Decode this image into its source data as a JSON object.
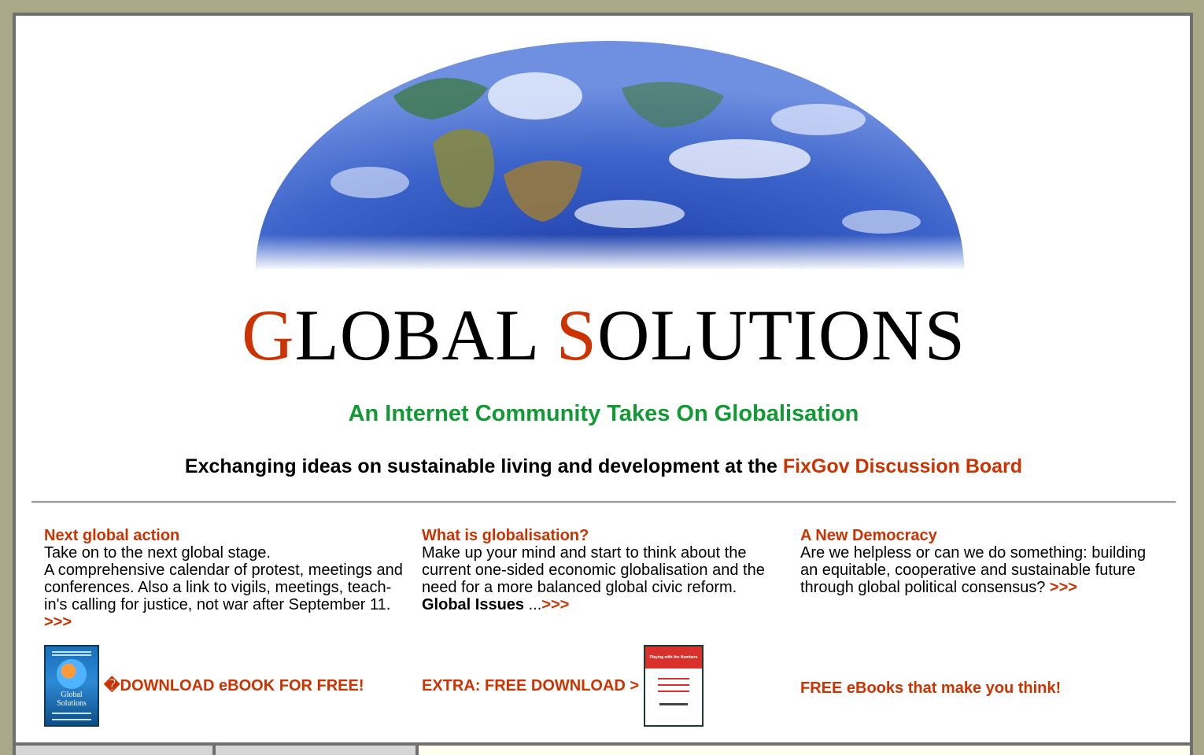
{
  "header": {
    "title_initial_1": "G",
    "title_rest_1": "LOBAL",
    "title_initial_2": "S",
    "title_rest_2": "OLUTIONS",
    "tagline": "An Internet Community Takes On Globalisation",
    "exchange_text": "Exchanging ideas on sustainable living and development at the",
    "exchange_link": "FixGov Discussion Board"
  },
  "columns": [
    {
      "heading": "Next global action",
      "line1": "Take on to the next global stage.",
      "body": "A comprehensive calendar of protest, meetings and conferences. Also a link to vigils, meetings, teach-in's calling for justice, not war after September 11.",
      "more": ">>>"
    },
    {
      "heading": "What is globalisation?",
      "body": "Make up your mind and start to think about the current one-sided economic globalisation and the need for a more balanced global civic reform.",
      "bold_link": "Global Issues",
      "ellipsis": " ...",
      "more": ">>>"
    },
    {
      "heading": "A New Democracy",
      "body": "Are we helpless or can we do something: building an equitable, cooperative and sustainable future through global political consensus?",
      "more": ">>>"
    }
  ],
  "promos": {
    "download_ebook": "�DOWNLOAD eBOOK FOR FREE!",
    "extra_download": "EXTRA: FREE DOWNLOAD >",
    "free_ebooks": "FREE eBooks that make you think!"
  },
  "book_covers": {
    "global_solutions_title": "Global Solutions",
    "playing_numbers_title": "Playing with the Numbers"
  },
  "colors": {
    "accent": "#cc3300",
    "tagline_green": "#119933",
    "page_bg": "#a9a987"
  }
}
